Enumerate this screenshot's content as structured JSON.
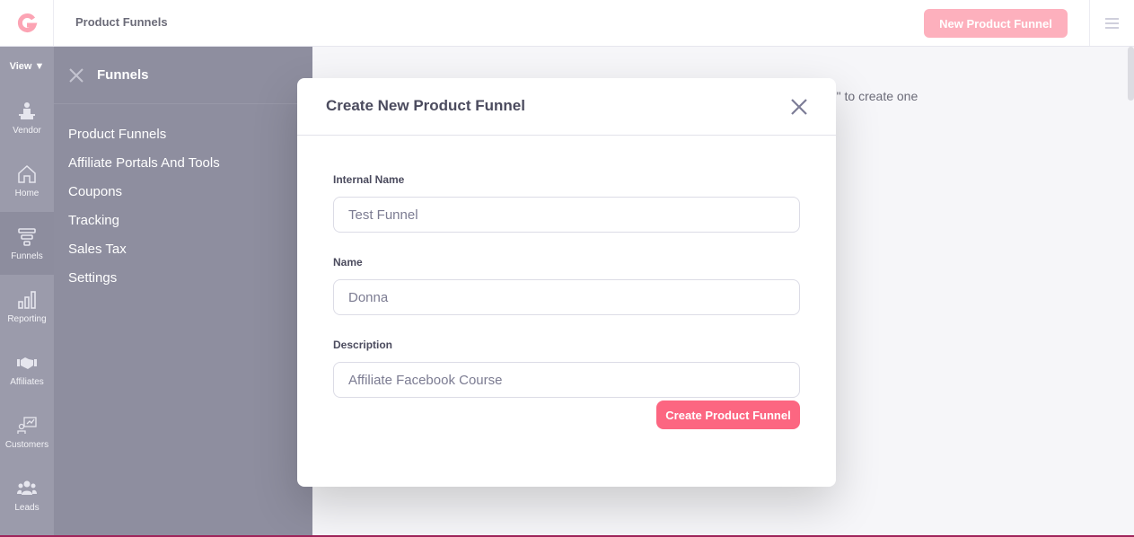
{
  "header": {
    "title": "Product Funnels",
    "new_button_label": "New Product Funnel",
    "logo_icon": "brand-logo-icon",
    "menu_icon": "hamburger-icon"
  },
  "iconbar": {
    "view_label": "View ▼",
    "items": [
      {
        "label": "Vendor",
        "icon": "vendor-icon",
        "active": false
      },
      {
        "label": "Home",
        "icon": "home-icon",
        "active": false
      },
      {
        "label": "Funnels",
        "icon": "funnel-icon",
        "active": true
      },
      {
        "label": "Reporting",
        "icon": "bar-chart-icon",
        "active": false
      },
      {
        "label": "Affiliates",
        "icon": "handshake-icon",
        "active": false
      },
      {
        "label": "Customers",
        "icon": "presentation-icon",
        "active": false
      },
      {
        "label": "Leads",
        "icon": "users-icon",
        "active": false
      }
    ]
  },
  "subnav": {
    "title": "Funnels",
    "links": [
      "Product Funnels",
      "Affiliate Portals And Tools",
      "Coupons",
      "Tracking",
      "Sales Tax",
      "Settings"
    ]
  },
  "main": {
    "hint_text": "te\" to create one"
  },
  "modal": {
    "title": "Create New Product Funnel",
    "fields": [
      {
        "label": "Internal Name",
        "value": "Test Funnel"
      },
      {
        "label": "Name",
        "value": "Donna"
      },
      {
        "label": "Description",
        "value": "Affiliate Facebook Course"
      }
    ],
    "submit_label": "Create Product Funnel"
  },
  "colors": {
    "accent": "#fc6681",
    "accent_disabled": "#fdb0bd",
    "sidebar": "#8e8e9f",
    "iconbar": "#9b9bab"
  }
}
